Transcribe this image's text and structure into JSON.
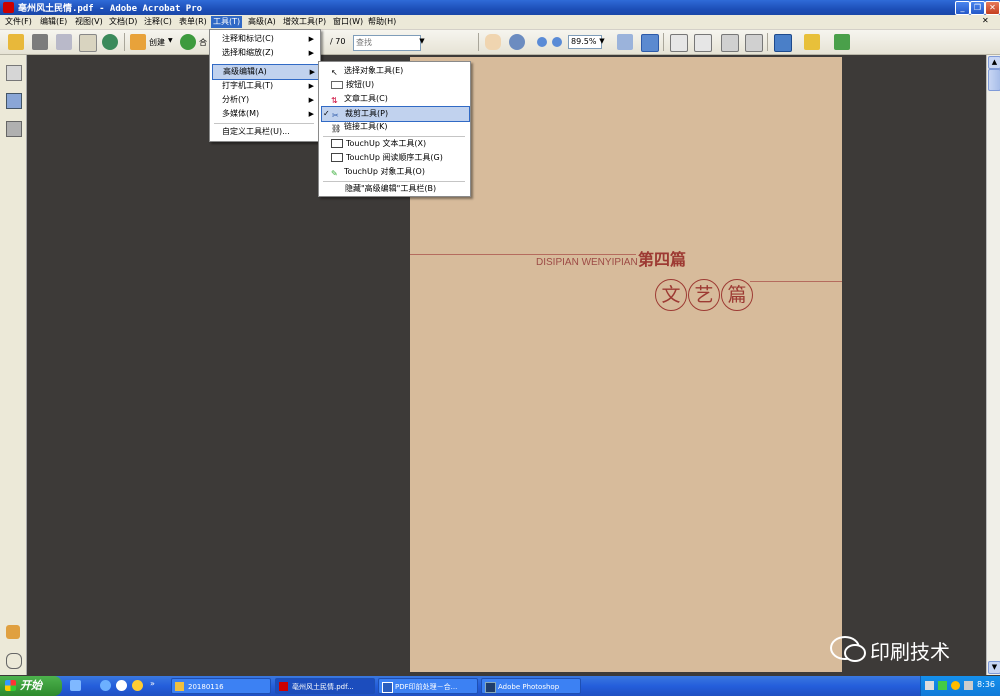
{
  "window": {
    "title": "亳州风土民情.pdf - Adobe Acrobat Pro"
  },
  "menubar": {
    "items": [
      {
        "label": "文件(F)"
      },
      {
        "label": "编辑(E)"
      },
      {
        "label": "视图(V)"
      },
      {
        "label": "文档(D)"
      },
      {
        "label": "注释(C)"
      },
      {
        "label": "表单(R)"
      },
      {
        "label": "工具(T)"
      },
      {
        "label": "高级(A)"
      },
      {
        "label": "增效工具(P)"
      },
      {
        "label": "窗口(W)"
      },
      {
        "label": "帮助(H)"
      }
    ]
  },
  "toolbar": {
    "create_label": "创建",
    "combine_label": "合",
    "page_total": "/ 70",
    "find_placeholder": "查找",
    "zoom": "89.5%"
  },
  "tools_menu": {
    "items": [
      {
        "label": "注释和标记(C)"
      },
      {
        "label": "选择和缩放(Z)"
      },
      {
        "label": "高级编辑(A)"
      },
      {
        "label": "打字机工具(T)"
      },
      {
        "label": "分析(Y)"
      },
      {
        "label": "多媒体(M)"
      },
      {
        "label": "自定义工具栏(U)..."
      }
    ]
  },
  "advanced_edit_menu": {
    "items": [
      {
        "label": "选择对象工具(E)"
      },
      {
        "label": "按钮(U)"
      },
      {
        "label": "文章工具(C)"
      },
      {
        "label": "裁剪工具(P)"
      },
      {
        "label": "链接工具(K)"
      },
      {
        "label": "TouchUp 文本工具(X)"
      },
      {
        "label": "TouchUp 阅读顺序工具(G)"
      },
      {
        "label": "TouchUp 对象工具(O)"
      },
      {
        "label": "隐藏\"高级编辑\"工具栏(B)"
      }
    ]
  },
  "page": {
    "subtitle": "DISIPIAN WENYIPIAN",
    "chapter": "第四篇",
    "circles": [
      "文",
      "艺",
      "篇"
    ]
  },
  "taskbar": {
    "start_label": "开始",
    "tasks": [
      {
        "label": "20180116"
      },
      {
        "label": "亳州风土民情.pdf..."
      },
      {
        "label": "PDF印前处理－合..."
      },
      {
        "label": "Adobe Photoshop"
      }
    ],
    "clock": "8:36"
  },
  "watermark": {
    "text": "印刷技术"
  }
}
